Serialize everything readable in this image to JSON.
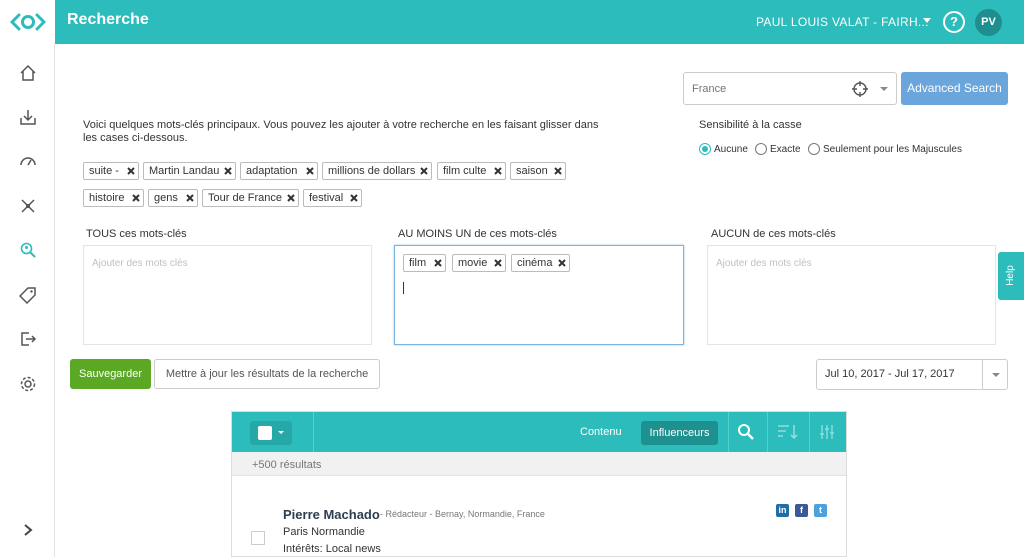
{
  "header": {
    "title": "Recherche",
    "user_name": "PAUL LOUIS VALAT - FAIRH...",
    "help_label": "?",
    "avatar_initials": "PV",
    "accent_color": "#2bbcbb"
  },
  "sidebar": {
    "items": [
      {
        "icon": "home-icon"
      },
      {
        "icon": "inbox-download-icon"
      },
      {
        "icon": "dashboard-gauge-icon"
      },
      {
        "icon": "network-icon"
      },
      {
        "icon": "search-people-icon",
        "active": true
      },
      {
        "icon": "tag-icon"
      },
      {
        "icon": "export-icon"
      },
      {
        "icon": "settings-gear-icon"
      }
    ],
    "expand_icon": "chevron-right-icon"
  },
  "location": {
    "placeholder": "France",
    "advanced_search_label": "Advanced Search"
  },
  "intro_text": "Voici quelques mots-clés principaux. Vous pouvez les ajouter à votre recherche en les faisant glisser dans les cases ci-dessous.",
  "suggested_keywords": [
    "suite -",
    "Martin Landau",
    "adaptation",
    "millions de dollars",
    "film culte",
    "saison",
    "histoire",
    "gens",
    "Tour de France",
    "festival"
  ],
  "case_sensitivity": {
    "title": "Sensibilité à la casse",
    "options": [
      "Aucune",
      "Exacte",
      "Seulement pour les Majuscules"
    ],
    "selected": "Aucune"
  },
  "keyword_boxes": {
    "all": {
      "title": "TOUS ces mots-clés",
      "placeholder": "Ajouter des mots clés"
    },
    "any": {
      "title": "AU MOINS UN de ces mots-clés",
      "tags": [
        "film",
        "movie",
        "cinéma"
      ]
    },
    "none": {
      "title": "AUCUN de ces mots-clés",
      "placeholder": "Ajouter des mots clés"
    }
  },
  "help_tab_label": "Help",
  "actions": {
    "save_label": "Sauvegarder",
    "update_label": "Mettre à jour les résultats de la recherche",
    "date_range": "Jul 10, 2017 - Jul 17, 2017"
  },
  "results": {
    "tab_content": "Contenu",
    "tab_influencers": "Influenceurs",
    "count_label": "+500 résultats",
    "items": [
      {
        "name": "Pierre Machado",
        "meta": "- Rédacteur - Bernay, Normandie, France",
        "organization": "Paris Normandie",
        "interests": "Intérêts: Local news",
        "social": [
          "linkedin-icon",
          "facebook-icon",
          "twitter-icon"
        ]
      }
    ]
  }
}
